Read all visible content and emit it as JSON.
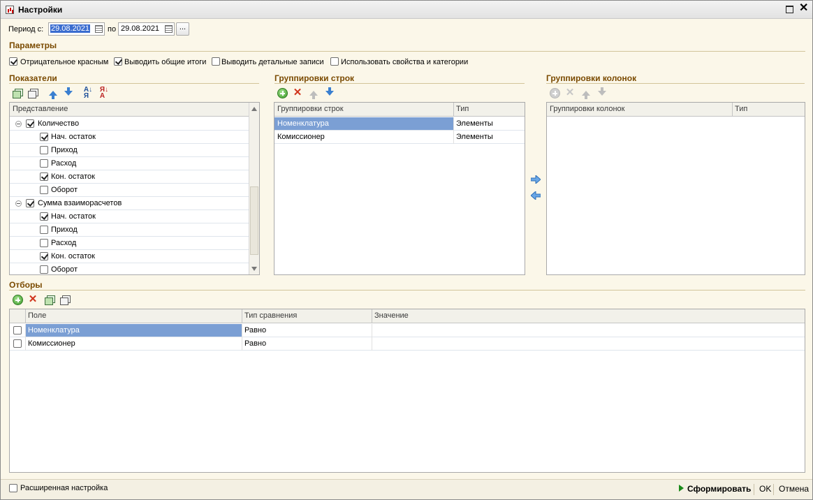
{
  "window": {
    "title": "Настройки"
  },
  "period": {
    "label_from": "Период с:",
    "from": "29.08.2021",
    "label_to": "по",
    "to": "29.08.2021",
    "dots": "..."
  },
  "params": {
    "title": "Параметры",
    "items": [
      {
        "label": "Отрицательное красным",
        "checked": true
      },
      {
        "label": "Выводить общие итоги",
        "checked": true
      },
      {
        "label": "Выводить детальные записи",
        "checked": false
      },
      {
        "label": "Использовать свойства и категории",
        "checked": false
      }
    ]
  },
  "indicators": {
    "title": "Показатели",
    "header": "Представление",
    "rows": [
      {
        "label": "Количество",
        "checked": true,
        "level": 0
      },
      {
        "label": "Нач. остаток",
        "checked": true,
        "level": 1
      },
      {
        "label": "Приход",
        "checked": false,
        "level": 1
      },
      {
        "label": "Расход",
        "checked": false,
        "level": 1
      },
      {
        "label": "Кон. остаток",
        "checked": true,
        "level": 1
      },
      {
        "label": "Оборот",
        "checked": false,
        "level": 1
      },
      {
        "label": "Сумма взаиморасчетов",
        "checked": true,
        "level": 0
      },
      {
        "label": "Нач. остаток",
        "checked": true,
        "level": 1
      },
      {
        "label": "Приход",
        "checked": false,
        "level": 1
      },
      {
        "label": "Расход",
        "checked": false,
        "level": 1
      },
      {
        "label": "Кон. остаток",
        "checked": true,
        "level": 1
      },
      {
        "label": "Оборот",
        "checked": false,
        "level": 1
      }
    ]
  },
  "row_groups": {
    "title": "Группировки строк",
    "columns": [
      "Группировки строк",
      "Тип"
    ],
    "rows": [
      {
        "name": "Номенклатура",
        "type": "Элементы",
        "selected": true
      },
      {
        "name": "Комиссионер",
        "type": "Элементы",
        "selected": false
      }
    ]
  },
  "col_groups": {
    "title": "Группировки колонок",
    "columns": [
      "Группировки колонок",
      "Тип"
    ],
    "rows": []
  },
  "filters": {
    "title": "Отборы",
    "columns": [
      "Поле",
      "Тип сравнения",
      "Значение"
    ],
    "rows": [
      {
        "field": "Номенклатура",
        "compare": "Равно",
        "value": "",
        "checked": false,
        "selected": true
      },
      {
        "field": "Комиссионер",
        "compare": "Равно",
        "value": "",
        "checked": false,
        "selected": false
      }
    ]
  },
  "footer": {
    "advanced": "Расширенная настройка",
    "advanced_checked": false,
    "generate": "Сформировать",
    "ok": "OK",
    "cancel": "Отмена"
  },
  "colors": {
    "section": "#7a4a00",
    "selection": "#7b9fd4",
    "background": "#fbf7e9"
  }
}
